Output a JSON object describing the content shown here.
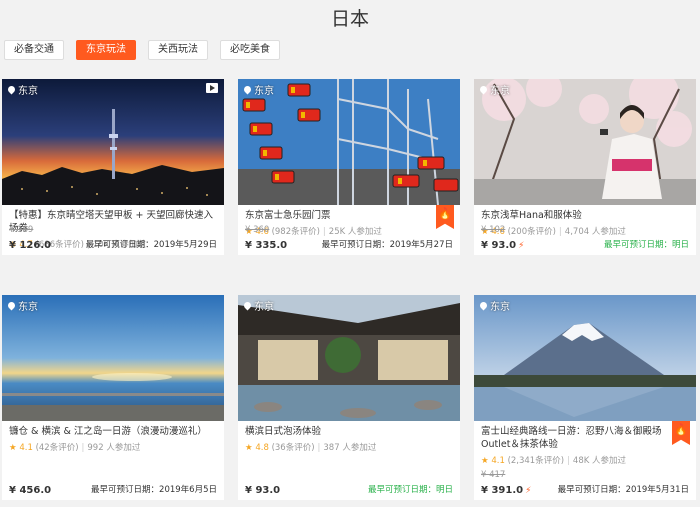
{
  "page": {
    "title": "日本"
  },
  "tabs": [
    {
      "label": "必备交通",
      "active": false
    },
    {
      "label": "东京玩法",
      "active": true
    },
    {
      "label": "关西玩法",
      "active": false
    },
    {
      "label": "必吃美食",
      "active": false
    }
  ],
  "cards": [
    {
      "location": "东京",
      "has_video": true,
      "hot_badge": false,
      "title": "【特惠】东京晴空塔天望甲板 + 天望回廊快速入场券",
      "rating": "4.7",
      "reviews": "(686条评价)",
      "joined": "10K 人参加过",
      "old_price": "¥ 189",
      "price": "¥ 126.0",
      "instant": false,
      "date": "最早可预订日期：2019年5月29日",
      "date_color": "normal"
    },
    {
      "location": "东京",
      "has_video": false,
      "hot_badge": true,
      "title": "东京富士急乐园门票",
      "rating": "4.6",
      "reviews": "(982条评价)",
      "joined": "25K 人参加过",
      "old_price": "¥ 360",
      "price": "¥ 335.0",
      "instant": false,
      "date": "最早可预订日期：2019年5月27日",
      "date_color": "normal"
    },
    {
      "location": "东京",
      "has_video": false,
      "hot_badge": false,
      "title": "东京浅草Hana和服体验",
      "rating": "4.6",
      "reviews": "(200条评价)",
      "joined": "4,704 人参加过",
      "old_price": "¥ 102",
      "price": "¥ 93.0",
      "instant": true,
      "date": "最早可预订日期：明日",
      "date_color": "green"
    },
    {
      "location": "东京",
      "has_video": false,
      "hot_badge": false,
      "title": "镰仓 & 横滨 & 江之岛一日游（浪漫动漫巡礼）",
      "rating": "4.1",
      "reviews": "(42条评价)",
      "joined": "992 人参加过",
      "old_price": "",
      "price": "¥ 456.0",
      "instant": false,
      "date": "最早可预订日期：2019年6月5日",
      "date_color": "normal"
    },
    {
      "location": "东京",
      "has_video": false,
      "hot_badge": false,
      "title": "横滨日式泡汤体验",
      "rating": "4.8",
      "reviews": "(36条评价)",
      "joined": "387 人参加过",
      "old_price": "",
      "price": "¥ 93.0",
      "instant": false,
      "date": "最早可预订日期：明日",
      "date_color": "green"
    },
    {
      "location": "东京",
      "has_video": false,
      "hot_badge": true,
      "title": "富士山经典路线一日游：忍野八海＆御殿场Outlet＆抹茶体验",
      "rating": "4.1",
      "reviews": "(2,341条评价)",
      "joined": "48K 人参加过",
      "old_price": "¥ 417",
      "price": "¥ 391.0",
      "instant": true,
      "date": "最早可预订日期：2019年5月31日",
      "date_color": "normal"
    }
  ],
  "colors": {
    "accent": "#ff5a1f",
    "green": "#2bb24c",
    "star": "#f5a623"
  },
  "icons": {
    "location": "map-pin-icon",
    "video": "video-play-icon",
    "hot": "flame-icon",
    "instant": "lightning-icon",
    "star": "star-icon"
  }
}
